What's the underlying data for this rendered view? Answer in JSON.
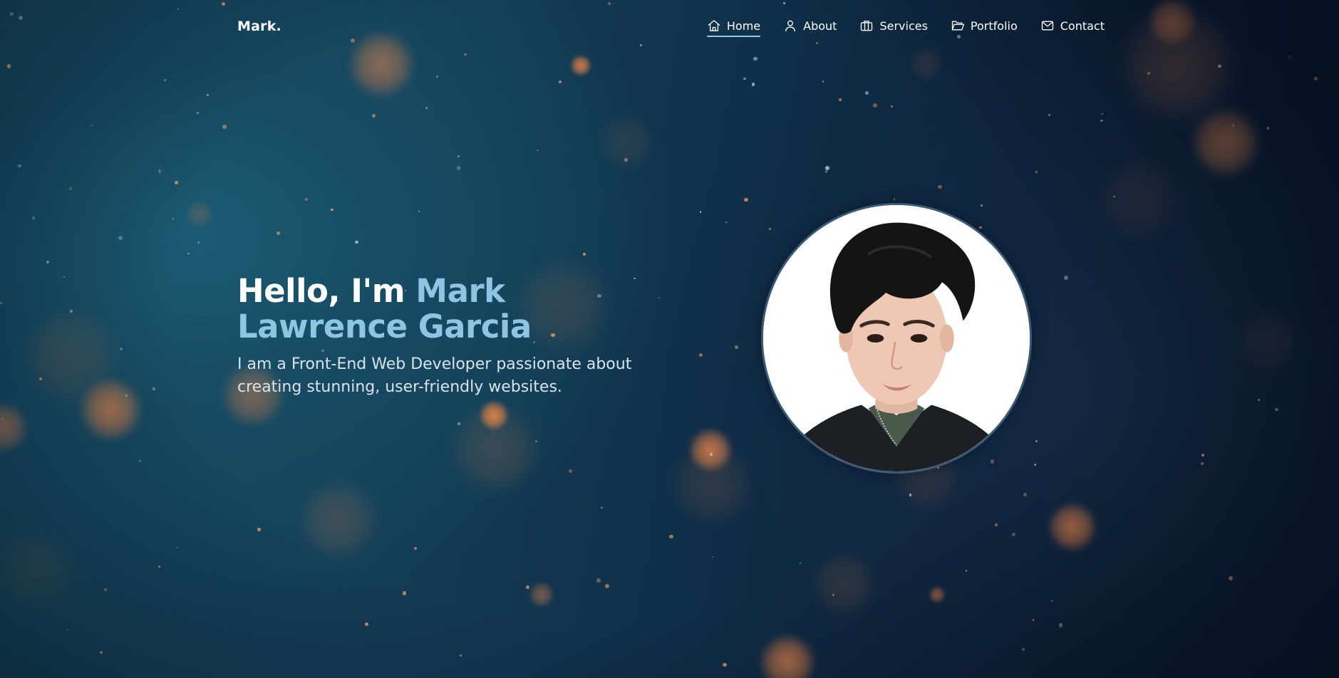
{
  "header": {
    "logo": "Mark.",
    "nav": [
      {
        "label": "Home",
        "icon": "home-icon",
        "active": true
      },
      {
        "label": "About",
        "icon": "user-icon",
        "active": false
      },
      {
        "label": "Services",
        "icon": "briefcase-icon",
        "active": false
      },
      {
        "label": "Portfolio",
        "icon": "folder-icon",
        "active": false
      },
      {
        "label": "Contact",
        "icon": "mail-icon",
        "active": false
      }
    ]
  },
  "hero": {
    "greeting": "Hello, I'm ",
    "name_first": "Mark",
    "name_rest": "Lawrence Garcia",
    "subtitle": "I am a Front-End Web Developer passionate about creating stunning, user-friendly websites."
  },
  "colors": {
    "accent": "#8ec5e3",
    "background_dark": "#0a1c33",
    "background_teal": "#174e66",
    "bokeh_orange": "#f0884a"
  }
}
